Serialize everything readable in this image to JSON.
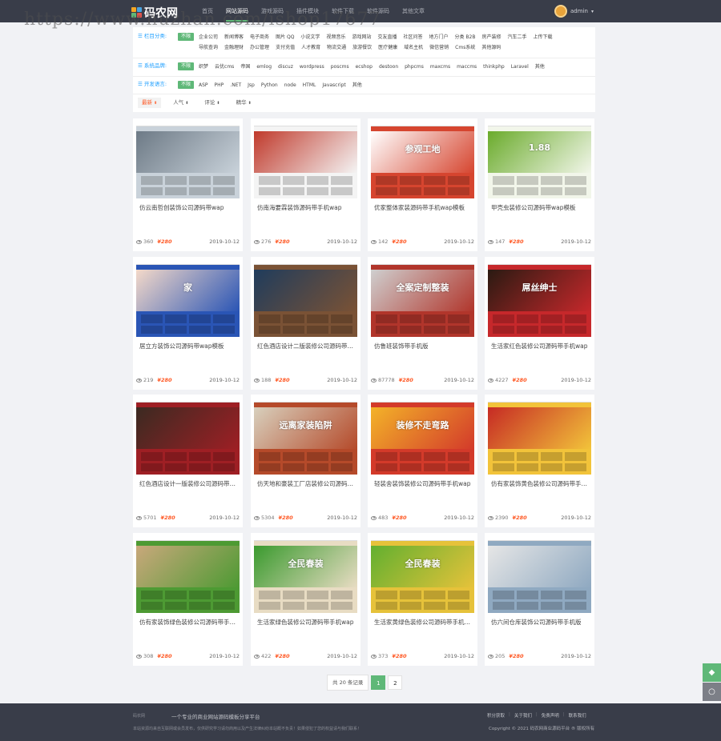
{
  "header": {
    "logo_text": "码农网",
    "nav": [
      "首页",
      "网站源码",
      "游戏源码",
      "插件模块",
      "软件下载",
      "软件源码",
      "其他文章"
    ],
    "active_nav": 1,
    "username": "admin",
    "caret": "▾"
  },
  "watermark": "https://www.huzhan.com/ishop17677",
  "filters": {
    "tag_all": "不限",
    "rows": [
      {
        "label": "栏目分类:",
        "items": [
          "企业公司",
          "新闻博客",
          "电子商务",
          "图片 QQ",
          "小说文学",
          "视频音乐",
          "游戏网站",
          "交友直播",
          "社区问答",
          "地方门户",
          "分类 B2B",
          "房产装修",
          "汽车二手",
          "上传下载",
          "导航查询",
          "金融理财",
          "办公管理",
          "支付充值",
          "人才教育",
          "物流交通",
          "旅游餐饮",
          "医疗健康",
          "域名主机",
          "微信营销",
          "Cms系统",
          "其他源码"
        ]
      },
      {
        "label": "系统品牌:",
        "items": [
          "织梦",
          "云优cms",
          "帝国",
          "emlog",
          "discuz",
          "wordpress",
          "poscms",
          "ecshop",
          "destoon",
          "phpcms",
          "maxcms",
          "maccms",
          "thinkphp",
          "Laravel",
          "其他"
        ]
      },
      {
        "label": "开发语言:",
        "items": [
          "ASP",
          "PHP",
          ".NET",
          "Jsp",
          "Python",
          "node",
          "HTML",
          "Javascript",
          "其他"
        ]
      }
    ],
    "sorts": [
      {
        "label": "最新",
        "active": true
      },
      {
        "label": "人气",
        "active": false
      },
      {
        "label": "评论",
        "active": false
      },
      {
        "label": "精华",
        "active": false
      }
    ],
    "sort_arrow": "⬍"
  },
  "price_label": "¥280",
  "cards": [
    {
      "title": "仿云南哲创装饰公司源码带wap",
      "views": "360",
      "date": "2019-10-12",
      "colors": [
        "#6d7a86",
        "#c9d2da"
      ],
      "thumb_text": ""
    },
    {
      "title": "仿南海要霖装饰源码带手机wap",
      "views": "276",
      "date": "2019-10-12",
      "colors": [
        "#c0392b",
        "#f4f4f4"
      ],
      "thumb_text": ""
    },
    {
      "title": "优家整体家装源码带手机wap模板",
      "views": "142",
      "date": "2019-10-12",
      "colors": [
        "#ffffff",
        "#d6452f"
      ],
      "thumb_text": "参观工地"
    },
    {
      "title": "甲壳虫装修公司源码带wap模板",
      "views": "147",
      "date": "2019-10-12",
      "colors": [
        "#6aab2b",
        "#f2f6ea"
      ],
      "thumb_text": "1.88"
    },
    {
      "title": "居立方装饰公司源码带wap模板",
      "views": "219",
      "date": "2019-10-12",
      "colors": [
        "#f4d9c9",
        "#2a55b5"
      ],
      "thumb_text": "家"
    },
    {
      "title": "红色酒店设计二版装修公司源码带wap",
      "views": "188",
      "date": "2019-10-12",
      "colors": [
        "#1f3c5c",
        "#7a5235"
      ],
      "thumb_text": ""
    },
    {
      "title": "仿鲁班装饰带手机版",
      "views": "87778",
      "date": "2019-10-12",
      "colors": [
        "#cfcfcf",
        "#b1352b"
      ],
      "thumb_text": "全案定制整装"
    },
    {
      "title": "生活家红色装修公司源码带手机wap",
      "views": "4227",
      "date": "2019-10-12",
      "colors": [
        "#2a1a12",
        "#c6282b"
      ],
      "thumb_text": "屌丝绅士"
    },
    {
      "title": "红色酒店设计一版装修公司源码带wap",
      "views": "5701",
      "date": "2019-10-12",
      "colors": [
        "#3b2a22",
        "#9e1f24"
      ],
      "thumb_text": ""
    },
    {
      "title": "仿天地和豪装工厂店装修公司源码带wap",
      "views": "5304",
      "date": "2019-10-12",
      "colors": [
        "#d8d0bd",
        "#b54a2a"
      ],
      "thumb_text": "远离家装陷阱"
    },
    {
      "title": "轻装舍装饰装修公司源码带手机wap",
      "views": "483",
      "date": "2019-10-12",
      "colors": [
        "#f3b329",
        "#d33a2a"
      ],
      "thumb_text": "装修不走弯路"
    },
    {
      "title": "仿有家装饰黄色装修公司源码带手机wap",
      "views": "2390",
      "date": "2019-10-12",
      "colors": [
        "#c62a24",
        "#f2c33a"
      ],
      "thumb_text": ""
    },
    {
      "title": "仿有家装饰绿色装修公司源码带手机wap",
      "views": "308",
      "date": "2019-10-12",
      "colors": [
        "#c9a87b",
        "#4d9a33"
      ],
      "thumb_text": ""
    },
    {
      "title": "生活家绿色装修公司源码带手机wap",
      "views": "422",
      "date": "2019-10-12",
      "colors": [
        "#3a9a2e",
        "#e8dcc3"
      ],
      "thumb_text": "全民春装"
    },
    {
      "title": "生活家黄绿色装修公司源码带手机wap",
      "views": "373",
      "date": "2019-10-12",
      "colors": [
        "#62b02f",
        "#e6c23a"
      ],
      "thumb_text": "全民春装"
    },
    {
      "title": "仿六间仓库装饰公司源码带手机版",
      "views": "205",
      "date": "2019-10-12",
      "colors": [
        "#e6e6e6",
        "#8fa9c1"
      ],
      "thumb_text": ""
    }
  ],
  "pagination": {
    "total": "共 20 条记录",
    "pages": [
      "1",
      "2"
    ],
    "active": 0
  },
  "floating": {
    "diamond_icon": "◆",
    "circle_icon": "○",
    "top_color": "#5fb878",
    "bottom_color": "#7c7f87"
  },
  "footer": {
    "logo": "码农网",
    "slogan": "一个专业的商业网站源码模板分享平台",
    "desc": "本站资源均来自互联网或会员发布，仅供研究学习请勿商用以及产生法律纠纷本站概不负责！如果侵犯了您的权益请与我们联系！",
    "links": [
      "积分获取",
      "关于我们",
      "免责声明",
      "联系我们"
    ],
    "copyright": "Copyright © 2021 码农网商业源码平台 ® 版权所有"
  }
}
